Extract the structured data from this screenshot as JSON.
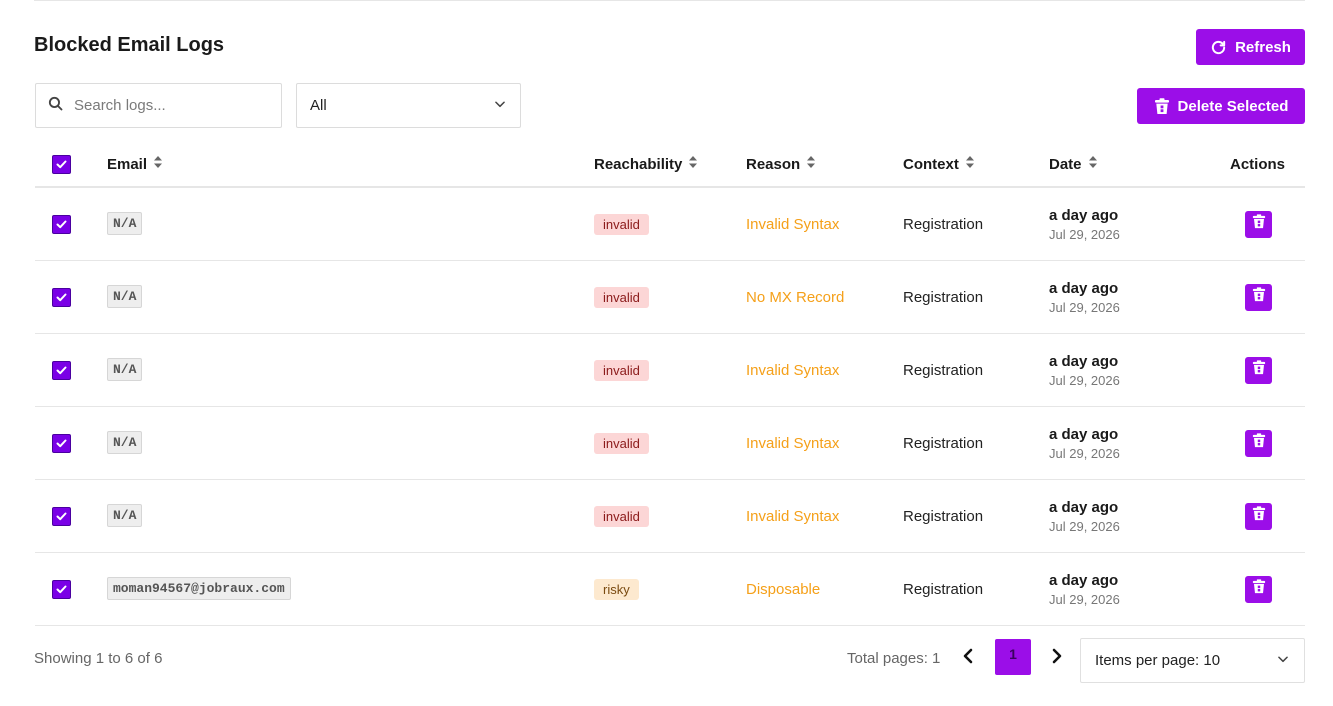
{
  "header": {
    "title": "Blocked Email Logs",
    "refresh_label": "Refresh",
    "delete_selected_label": "Delete Selected"
  },
  "filters": {
    "search_placeholder": "Search logs...",
    "status_selected": "All"
  },
  "table": {
    "columns": {
      "email": "Email",
      "reachability": "Reachability",
      "reason": "Reason",
      "context": "Context",
      "date": "Date",
      "actions": "Actions"
    },
    "rows": [
      {
        "email": "N/A",
        "reachability": "invalid",
        "reason": "Invalid Syntax",
        "context": "Registration",
        "date_relative": "a day ago",
        "date": "Jul 29, 2026"
      },
      {
        "email": "N/A",
        "reachability": "invalid",
        "reason": "No MX Record",
        "context": "Registration",
        "date_relative": "a day ago",
        "date": "Jul 29, 2026"
      },
      {
        "email": "N/A",
        "reachability": "invalid",
        "reason": "Invalid Syntax",
        "context": "Registration",
        "date_relative": "a day ago",
        "date": "Jul 29, 2026"
      },
      {
        "email": "N/A",
        "reachability": "invalid",
        "reason": "Invalid Syntax",
        "context": "Registration",
        "date_relative": "a day ago",
        "date": "Jul 29, 2026"
      },
      {
        "email": "N/A",
        "reachability": "invalid",
        "reason": "Invalid Syntax",
        "context": "Registration",
        "date_relative": "a day ago",
        "date": "Jul 29, 2026"
      },
      {
        "email": "moman94567@jobraux.com",
        "reachability": "risky",
        "reason": "Disposable",
        "context": "Registration",
        "date_relative": "a day ago",
        "date": "Jul 29, 2026"
      }
    ]
  },
  "pagination": {
    "showing": "Showing 1 to 6 of 6",
    "total_pages": "Total pages: 1",
    "current_page": "1",
    "items_per_page": "Items per page: 10"
  },
  "colors": {
    "accent": "#9b0ee8",
    "checkbox": "#7a00e6",
    "reason": "#f5a019",
    "invalid_bg": "#fcd6d6",
    "risky_bg": "#fde9cf"
  }
}
